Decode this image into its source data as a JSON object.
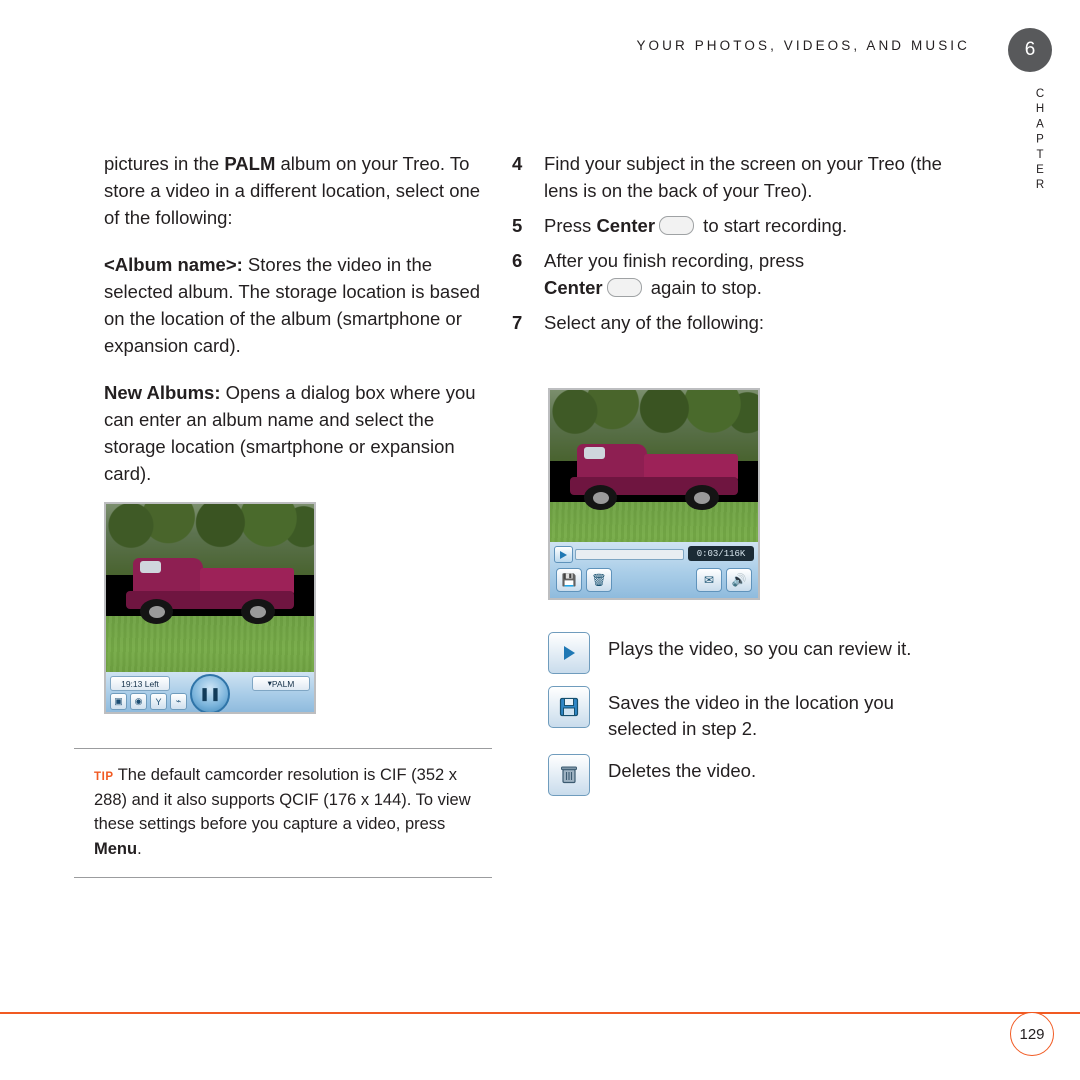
{
  "header": {
    "running_head": "YOUR PHOTOS, VIDEOS, AND MUSIC",
    "chapter_number": "6",
    "chapter_word": "CHAPTER"
  },
  "left_column": {
    "para1_pre": "pictures in the ",
    "para1_bold": "PALM",
    "para1_post": " album on your Treo. To store a video in a different location, select one of the following:",
    "para2_bold": "<Album name>:",
    "para2_text": " Stores the video in the selected album. The storage location is based on the location of the album (smartphone or expansion card).",
    "para3_bold": "New Albums:",
    "para3_text": " Opens a dialog box where you can enter an album name and select the storage location (smartphone or expansion card)."
  },
  "right_column": {
    "steps": [
      {
        "num": "4",
        "text": "Find your subject in the screen on your Treo (the lens is on the back of your Treo)."
      },
      {
        "num": "5",
        "pre": "Press ",
        "bold": "Center",
        "post": " to start recording."
      },
      {
        "num": "6",
        "pre": "After you finish recording, press ",
        "bold": "Center",
        "post": " again to stop."
      },
      {
        "num": "7",
        "text": "Select any of the following:"
      }
    ],
    "icon_items": [
      {
        "icon": "play-icon",
        "text": "Plays the video, so you can review it."
      },
      {
        "icon": "save-disk-icon",
        "text": "Saves the video in the location you selected in step 2."
      },
      {
        "icon": "trash-icon",
        "text": "Deletes the video."
      }
    ]
  },
  "screenshot_left": {
    "time_left": "19:13 Left",
    "album_chip": "PALM",
    "album_chip_caret": "▾",
    "icons": [
      "video-icon",
      "camera-icon",
      "network-icon"
    ]
  },
  "screenshot_right": {
    "counter": "0:03/116K",
    "toolbar_icons": [
      "save-disk-icon",
      "trash-icon",
      "mail-icon",
      "speaker-icon"
    ]
  },
  "tip": {
    "label": "TIP",
    "text_pre": "The default camcorder resolution is CIF (352 x 288) and it also supports QCIF (176 x 144). To view these settings before you capture a video, press ",
    "text_bold": "Menu",
    "text_post": "."
  },
  "footer": {
    "page_number": "129",
    "rule_color": "#f15a22"
  }
}
